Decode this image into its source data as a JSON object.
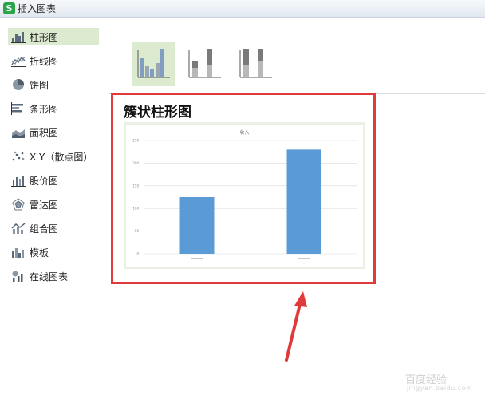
{
  "window": {
    "title": "插入图表",
    "app_logo": "S"
  },
  "sidebar": {
    "items": [
      {
        "label": "柱形图",
        "icon": "column-chart-icon",
        "selected": true
      },
      {
        "label": "折线图",
        "icon": "line-chart-icon",
        "selected": false
      },
      {
        "label": "饼图",
        "icon": "pie-chart-icon",
        "selected": false
      },
      {
        "label": "条形图",
        "icon": "bar-chart-icon",
        "selected": false
      },
      {
        "label": "面积图",
        "icon": "area-chart-icon",
        "selected": false
      },
      {
        "label": "X Y（散点图）",
        "icon": "scatter-chart-icon",
        "selected": false
      },
      {
        "label": "股价图",
        "icon": "stock-chart-icon",
        "selected": false
      },
      {
        "label": "雷达图",
        "icon": "radar-chart-icon",
        "selected": false
      },
      {
        "label": "组合图",
        "icon": "combo-chart-icon",
        "selected": false
      },
      {
        "label": "模板",
        "icon": "template-icon",
        "selected": false
      },
      {
        "label": "在线图表",
        "icon": "online-chart-icon",
        "selected": false
      }
    ]
  },
  "subtypes": [
    {
      "name": "clustered-column",
      "selected": true
    },
    {
      "name": "stacked-column",
      "selected": false
    },
    {
      "name": "percent-stacked-column",
      "selected": false
    }
  ],
  "preview": {
    "title": "簇状柱形图"
  },
  "chart_data": {
    "type": "bar",
    "title": "收入",
    "categories": [
      "",
      ""
    ],
    "values": [
      125,
      230
    ],
    "ylim": [
      0,
      250
    ],
    "yticks": [
      "0",
      "50",
      "100",
      "150",
      "200",
      "250"
    ],
    "bar_color": "#5b9bd5",
    "grid": true
  },
  "watermark": {
    "text": "百度经验",
    "sub": "jingyan.baidu.com"
  },
  "colors": {
    "accent_red": "#e03a3a",
    "selected_bg": "#dcebd0"
  }
}
